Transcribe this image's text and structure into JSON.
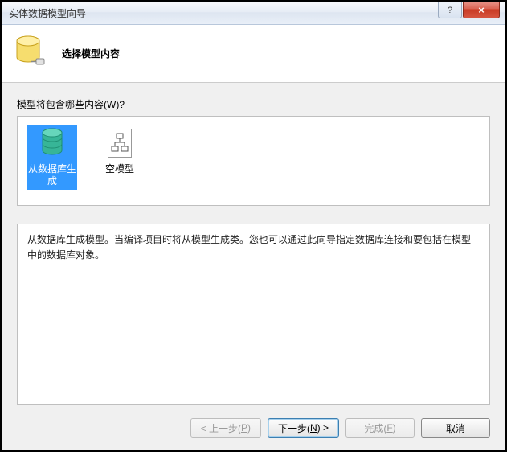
{
  "window": {
    "title": "实体数据模型向导",
    "help_symbol": "?",
    "close_symbol": "×"
  },
  "header": {
    "title": "选择模型内容"
  },
  "prompt": {
    "text_before": "模型将包含哪些内容(",
    "hotkey": "W",
    "text_after": ")?"
  },
  "options": [
    {
      "label": "从数据库生成",
      "selected": true,
      "icon": "database-icon"
    },
    {
      "label": "空模型",
      "selected": false,
      "icon": "diagram-icon"
    }
  ],
  "description": "从数据库生成模型。当编译项目时将从模型生成类。您也可以通过此向导指定数据库连接和要包括在模型中的数据库对象。",
  "buttons": {
    "prev": {
      "before": "< 上一步(",
      "hotkey": "P",
      "after": ")"
    },
    "next": {
      "before": "下一步(",
      "hotkey": "N",
      "after": ") >"
    },
    "finish": {
      "before": "完成(",
      "hotkey": "F",
      "after": ")"
    },
    "cancel": "取消"
  }
}
